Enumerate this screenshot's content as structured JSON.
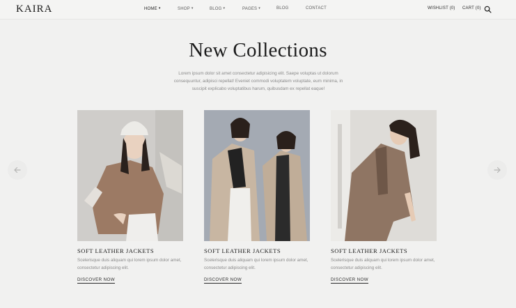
{
  "header": {
    "logo": "KAIRA",
    "nav": [
      {
        "label": "HOME",
        "dropdown": true,
        "active": true
      },
      {
        "label": "SHOP",
        "dropdown": true
      },
      {
        "label": "BLOG",
        "dropdown": true
      },
      {
        "label": "PAGES",
        "dropdown": true
      },
      {
        "label": "BLOG",
        "dropdown": false
      },
      {
        "label": "CONTACT",
        "dropdown": false
      }
    ],
    "wishlist": "WISHLIST (0)",
    "cart": "CART (0)",
    "search_icon": "search-icon"
  },
  "section": {
    "title": "New Collections",
    "intro": "Lorem ipsum dolor sit amet consectetur adipisicing elit. Saepe voluptas ut dolorum consequuntur, adipisci repellat! Eveniet commodi voluptatem voluptate, eum minima, in suscipit explicabo voluptatibus harum, quibusdam ex repellat eaque!"
  },
  "carousel": {
    "prev_icon": "arrow-left-icon",
    "next_icon": "arrow-right-icon"
  },
  "products": [
    {
      "title": "SOFT LEATHER JACKETS",
      "description": "Scelerisque duis aliquam qui lorem ipsum dolor amet, consectetur adipiscing elit.",
      "link": "DISCOVER NOW"
    },
    {
      "title": "SOFT LEATHER JACKETS",
      "description": "Scelerisque duis aliquam qui lorem ipsum dolor amet, consectetur adipiscing elit.",
      "link": "DISCOVER NOW"
    },
    {
      "title": "SOFT LEATHER JACKETS",
      "description": "Scelerisque duis aliquam qui lorem ipsum dolor amet, consectetur adipiscing elit.",
      "link": "DISCOVER NOW"
    }
  ],
  "colors": {
    "background": "#f1f1f0",
    "text": "#1b1b1b",
    "muted": "#8a8a8a"
  }
}
